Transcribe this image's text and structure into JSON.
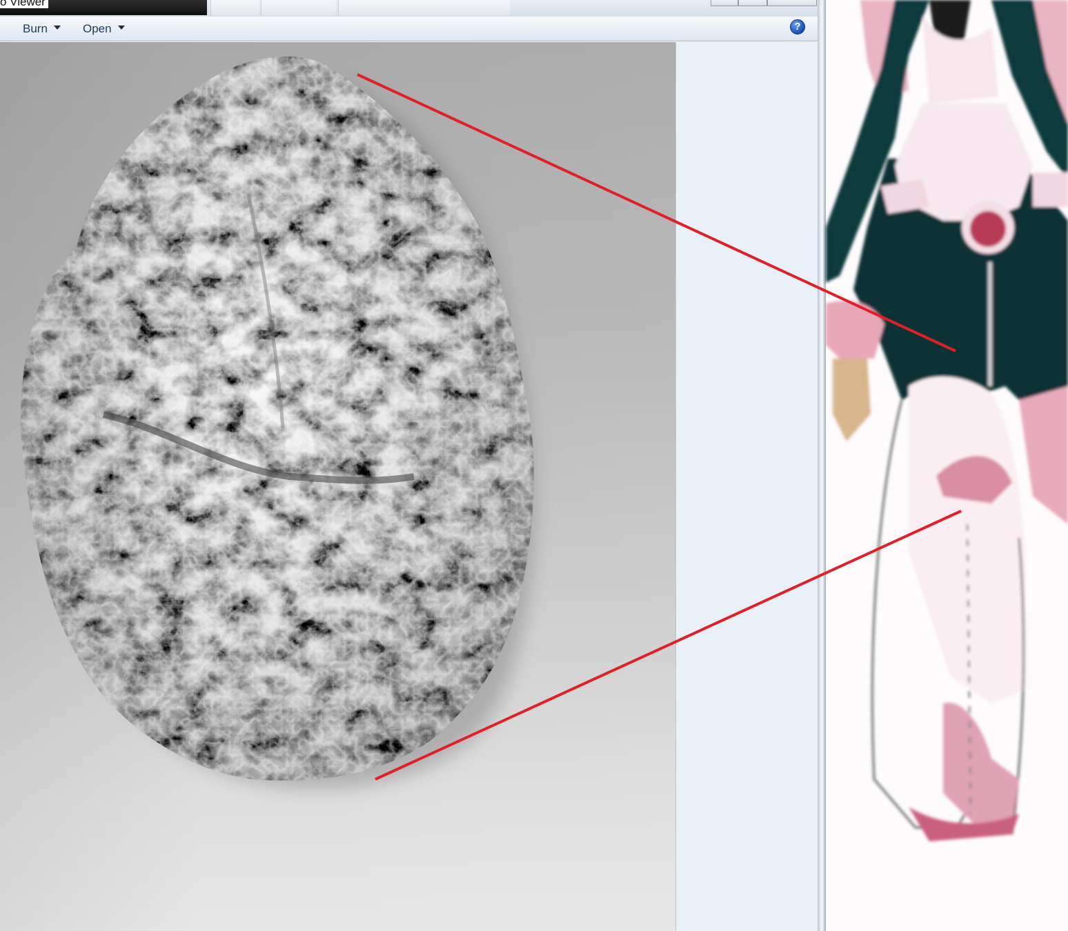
{
  "window": {
    "title": "o Viewer"
  },
  "command_bar": {
    "burn_label": "Burn",
    "open_label": "Open",
    "help_glyph": "?"
  },
  "icons": {
    "help": "help-icon",
    "menu_arrow": "dropdown-arrow-icon"
  },
  "colors": {
    "annotation_line": "#e02028",
    "command_text": "#1e395b",
    "help_blue": "#2059c2",
    "foil_background": "#b8b8b8",
    "side_pane": "#eaf0f8"
  }
}
